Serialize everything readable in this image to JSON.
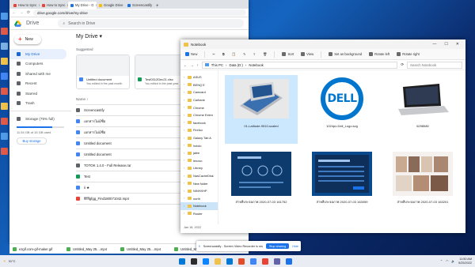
{
  "chrome": {
    "tabs": [
      {
        "label": "How to Sync",
        "color": "#ea4335",
        "active": false
      },
      {
        "label": "How to Sync",
        "color": "#ea4335",
        "active": false
      },
      {
        "label": "My Drive - G",
        "color": "#1a73e8",
        "active": true
      },
      {
        "label": "Google Drive",
        "color": "#fbbc04",
        "active": false
      },
      {
        "label": "Screencastify",
        "color": "#1a73e8",
        "active": false
      }
    ],
    "new_tab": "+",
    "url": "drive.google.com/drive/my-drive"
  },
  "drive": {
    "title": "Drive",
    "search_placeholder": "Search in Drive",
    "new_label": "New",
    "sidebar": [
      {
        "label": "My Drive",
        "active": true
      },
      {
        "label": "Computers",
        "active": false
      },
      {
        "label": "Shared with me",
        "active": false
      },
      {
        "label": "Recent",
        "active": false
      },
      {
        "label": "Starred",
        "active": false
      },
      {
        "label": "Trash",
        "active": false
      }
    ],
    "storage_label": "Storage (75% full)",
    "storage_text": "11.54 GB of 15 GB used",
    "buy_storage": "Buy storage",
    "my_drive": "My Drive ▾",
    "suggested": "Suggested",
    "suggested_cards": [
      {
        "name": "Untitled document",
        "sub": "You edited in the past month",
        "color": "#4285f4"
      },
      {
        "name": "Test0312Dec21.xlsx",
        "sub": "You edited in the past year",
        "color": "#0f9d58"
      }
    ],
    "name_header": "Name ↑",
    "files": [
      {
        "name": "Screencastify",
        "color": "#5f6368"
      },
      {
        "name": "เอกสารไม่มีชื่อ",
        "color": "#4285f4"
      },
      {
        "name": "เอกสารไม่มีชื่อ",
        "color": "#4285f4"
      },
      {
        "name": "Untitled document",
        "color": "#4285f4"
      },
      {
        "name": "Untitled document",
        "color": "#4285f4"
      },
      {
        "name": "TOTOK 1.4.0 - Full Release.rar",
        "color": "#5f6368"
      },
      {
        "name": "Test",
        "color": "#0f9d58"
      },
      {
        "name": "ii ★",
        "color": "#4285f4"
      },
      {
        "name": "ffffffgfgg_Find180071042.mp4",
        "color": "#ea4335"
      }
    ]
  },
  "explorer": {
    "title": "Notebook",
    "controls": [
      "—",
      "☐",
      "✕"
    ],
    "commands": [
      "New",
      "Sort",
      "View",
      "Set as background",
      "Rotate left",
      "Rotate right"
    ],
    "breadcrumb": [
      "This PC",
      "Data (D:)",
      "Notebook"
    ],
    "search_placeholder": "Search Notebook",
    "tree": [
      {
        "label": "ASUS",
        "selected": false
      },
      {
        "label": "BENQ E",
        "selected": false
      },
      {
        "label": "Camcard",
        "selected": false
      },
      {
        "label": "Carbank",
        "selected": false
      },
      {
        "label": "Chrome",
        "selected": false
      },
      {
        "label": "Chrome Exten",
        "selected": false
      },
      {
        "label": "facebook",
        "selected": false
      },
      {
        "label": "Firefox",
        "selected": false
      },
      {
        "label": "Galaxy Tab A",
        "selected": false
      },
      {
        "label": "hololo",
        "selected": false
      },
      {
        "label": "jalee",
        "selected": false
      },
      {
        "label": "lenovo",
        "selected": false
      },
      {
        "label": "Library",
        "selected": false
      },
      {
        "label": "NasCacheDisk",
        "selected": false
      },
      {
        "label": "New folder",
        "selected": false
      },
      {
        "label": "NINHXHP",
        "selected": false
      },
      {
        "label": "north",
        "selected": false
      },
      {
        "label": "Notebook",
        "selected": true
      },
      {
        "label": "Router",
        "selected": false
      }
    ],
    "items": [
      {
        "name": "01-Latitude-9510-scaled",
        "kind": "laptop-silver",
        "selected": true
      },
      {
        "name": "1024px-Dell_Logo.svg",
        "kind": "dell-logo",
        "selected": false
      },
      {
        "name": "6298580",
        "kind": "laptop-dark",
        "selected": false
      },
      {
        "name": "ส่าหลืบระจอภาพ 2020-07-03 161752",
        "kind": "blue-screen",
        "selected": false
      },
      {
        "name": "ส่าหลืบระจอภาพ 2020-07-03 163059",
        "kind": "blue-window",
        "selected": false
      },
      {
        "name": "ส่าหลืบระจอภาพ 2020-07-03 163201",
        "kind": "collage",
        "selected": false
      }
    ],
    "status": "Jan 18, 2022"
  },
  "share_bar": {
    "text": "Screencastify - Screen Video Recorder is sharing your screen.",
    "stop": "Stop sharing",
    "hide": "Hide"
  },
  "downloads": [
    "ezgif.com-gif-maker.gif",
    "Untitled_May 25....mp4",
    "Untitled_May 25....mp4",
    "Untitled_May 25....mp4"
  ],
  "taskbar": {
    "weather": "31°C",
    "time": "11:50 AM",
    "date": "5/25/2022",
    "icons": [
      "#0078d4",
      "#2b2b2b",
      "#0a84ff",
      "#f0c24b",
      "#0078d4",
      "#e34c26",
      "#4285f4",
      "#ea4335",
      "#6264a7",
      "#1a73e8"
    ]
  }
}
